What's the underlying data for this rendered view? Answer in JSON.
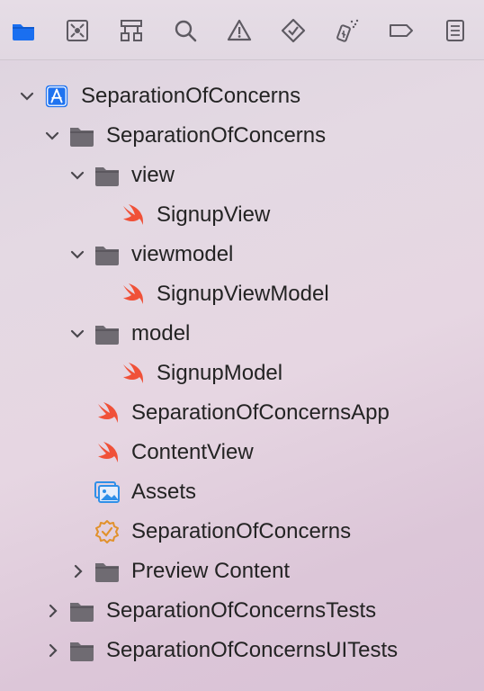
{
  "toolbar": {
    "icons": [
      {
        "name": "folder-icon",
        "active": true
      },
      {
        "name": "source-control-icon"
      },
      {
        "name": "symbol-hierarchy-icon"
      },
      {
        "name": "search-icon"
      },
      {
        "name": "warning-icon"
      },
      {
        "name": "test-diamond-icon"
      },
      {
        "name": "debug-spray-icon"
      },
      {
        "name": "breakpoint-tag-icon"
      },
      {
        "name": "report-list-icon"
      }
    ]
  },
  "tree": {
    "project": "SeparationOfConcerns",
    "group_main": "SeparationOfConcerns",
    "folder_view": "view",
    "file_signup_view": "SignupView",
    "folder_viewmodel": "viewmodel",
    "file_signup_view_model": "SignupViewModel",
    "folder_model": "model",
    "file_signup_model": "SignupModel",
    "file_app": "SeparationOfConcernsApp",
    "file_content_view": "ContentView",
    "file_assets": "Assets",
    "file_entitlements": "SeparationOfConcerns",
    "folder_preview": "Preview Content",
    "group_tests": "SeparationOfConcernsTests",
    "group_ui_tests": "SeparationOfConcernsUITests"
  },
  "colors": {
    "accent": "#1a6ff0",
    "folder_gray": "#6f6b72",
    "swift_orange": "#f05138",
    "entitlement_orange": "#e1912b",
    "assets_blue": "#2f8fe8"
  }
}
